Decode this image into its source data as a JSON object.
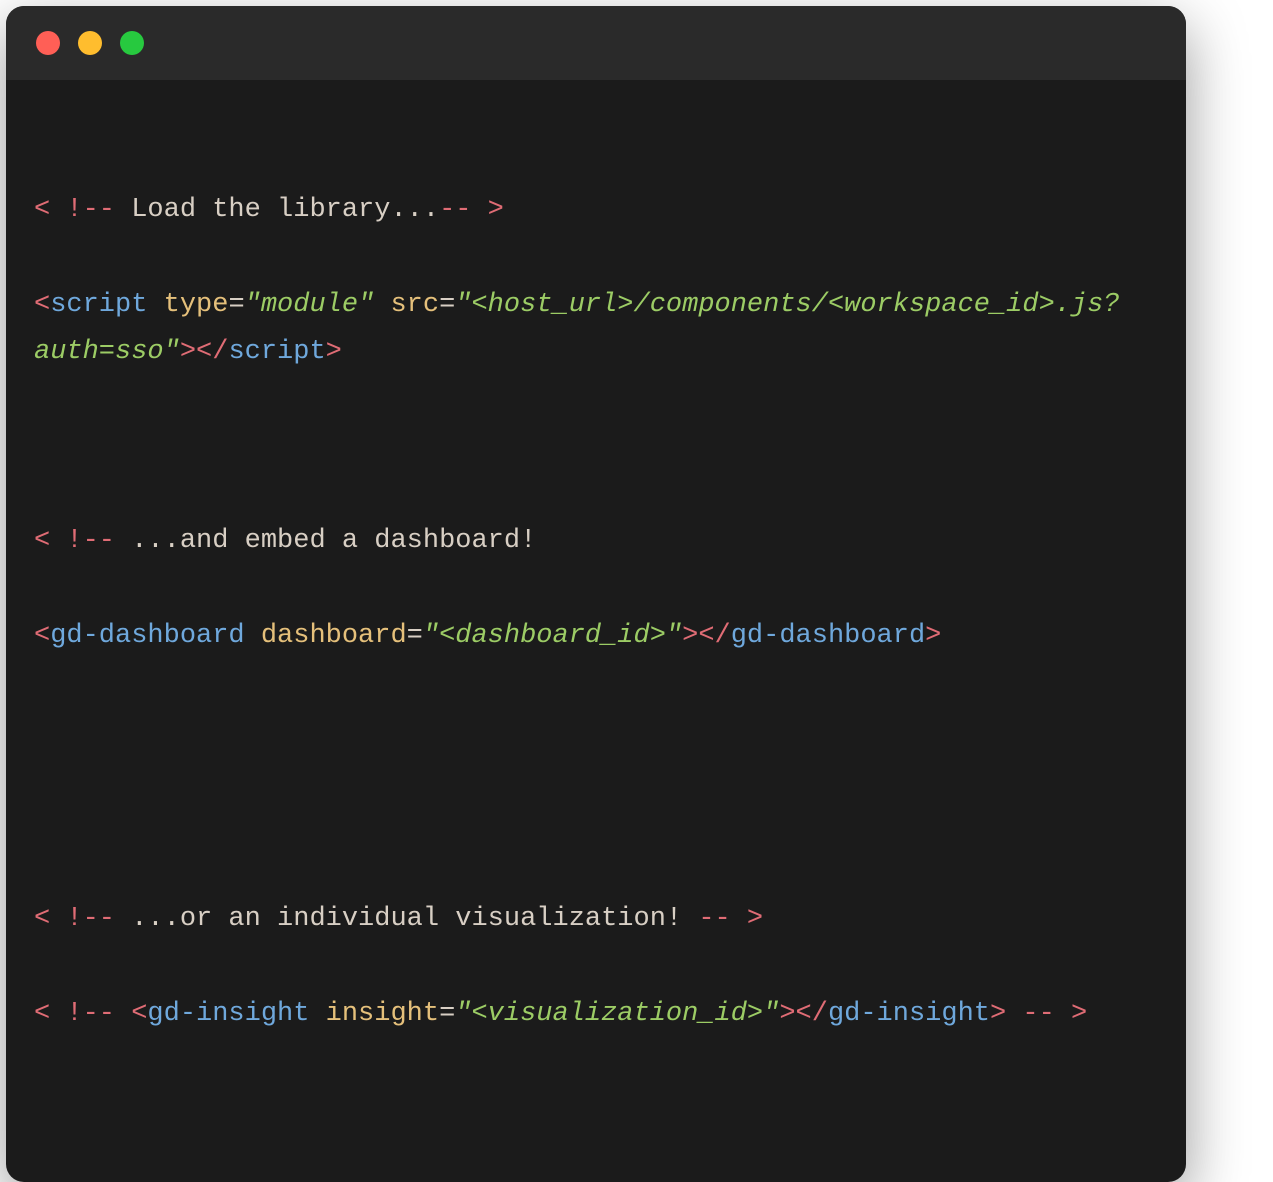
{
  "colors": {
    "window_bg": "#1b1b1b",
    "titlebar_bg": "#2a2a2a",
    "traffic_red": "#ff5f56",
    "traffic_yellow": "#ffbd2e",
    "traffic_green": "#27c93f",
    "syntax_bracket": "#e06c75",
    "syntax_tag": "#6fa8dc",
    "syntax_attr": "#e5c07b",
    "syntax_string": "#9ccc65",
    "syntax_text": "#d8cfc4"
  },
  "code": {
    "line1": {
      "open": "< !--",
      "text": " Load the library...",
      "close": "-- >"
    },
    "line2": {
      "lt": "<",
      "tag": "script",
      "sp1": " ",
      "attr1": "type",
      "eq1": "=",
      "val1": "\"module\"",
      "sp2": " ",
      "attr2": "src",
      "eq2": "=",
      "q2": "\"",
      "url": "<host_url>/components/<workspace_id>.js?auth=sso",
      "q2c": "\"",
      "gt": ">",
      "lt2": "<",
      "slash": "/",
      "tag2": "script",
      "gt2": ">"
    },
    "line4": {
      "open": "< !--",
      "text": " ...and embed a dashboard!"
    },
    "line5": {
      "lt": "<",
      "tag": "gd-dashboard",
      "sp": " ",
      "attr": "dashboard",
      "eq": "=",
      "q": "\"",
      "val": "<dashboard_id>",
      "qc": "\"",
      "gt": ">",
      "lt2": "<",
      "slash": "/",
      "tag2": "gd-dashboard",
      "gt2": ">"
    },
    "line7": {
      "open": "< !--",
      "text": " ...or an individual visualization! ",
      "close": "-- >"
    },
    "line8": {
      "open": "< !-- ",
      "lt": "<",
      "tag": "gd-insight",
      "sp": " ",
      "attr": "insight",
      "eq": "=",
      "q": "\"",
      "val": "<visualization_id>",
      "qc": "\"",
      "gt": ">",
      "lt2": "<",
      "slash": "/",
      "tag2": "gd-insight",
      "gt2": ">",
      "close": " -- >"
    }
  }
}
